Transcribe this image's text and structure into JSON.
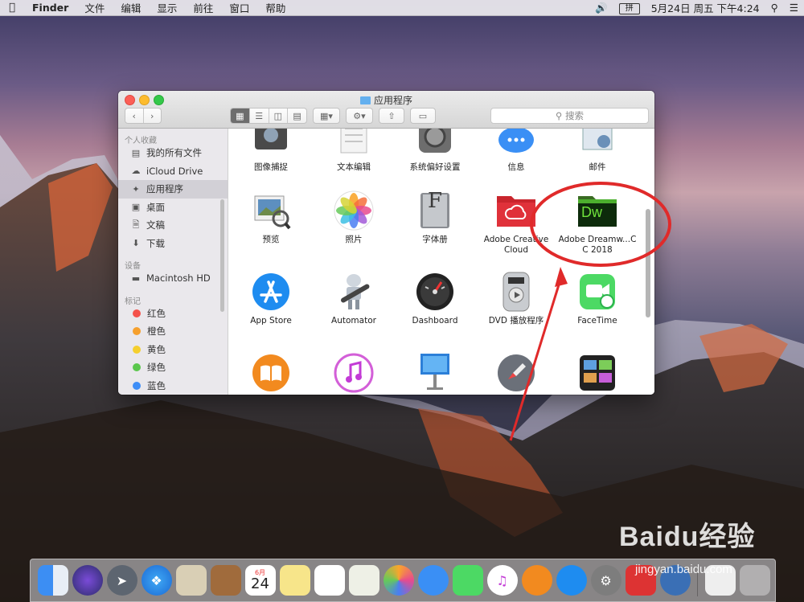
{
  "menubar": {
    "app_name": "Finder",
    "items": [
      "文件",
      "编辑",
      "显示",
      "前往",
      "窗口",
      "帮助"
    ],
    "ime": "拼",
    "clock": "5月24日 周五 下午4:24"
  },
  "window": {
    "title": "应用程序",
    "search_placeholder": "搜索"
  },
  "sidebar": {
    "favorites_header": "个人收藏",
    "favorites": [
      "我的所有文件",
      "iCloud Drive",
      "应用程序",
      "桌面",
      "文稿",
      "下载"
    ],
    "devices_header": "设备",
    "devices": [
      "Macintosh HD"
    ],
    "tags_header": "标记",
    "tags": [
      {
        "label": "红色",
        "color": "#f4524b"
      },
      {
        "label": "橙色",
        "color": "#f6a02d"
      },
      {
        "label": "黄色",
        "color": "#f5cf2e"
      },
      {
        "label": "绿色",
        "color": "#5bc74d"
      },
      {
        "label": "蓝色",
        "color": "#3e8ef7"
      }
    ]
  },
  "apps": {
    "row1": [
      "图像捕捉",
      "文本编辑",
      "系统偏好设置",
      "信息",
      "邮件"
    ],
    "row2": [
      "预览",
      "照片",
      "字体册",
      "Adobe Creative Cloud",
      "Adobe Dreamw...CC 2018"
    ],
    "row3": [
      "App Store",
      "Automator",
      "Dashboard",
      "DVD 播放程序",
      "FaceTime"
    ],
    "dw_icon_text": "Dw",
    "font_icon_text": "F"
  },
  "dock": {
    "calendar_month": "6月",
    "calendar_day": "24"
  },
  "watermark": {
    "brand": "Baidu经验",
    "url": "jingyan.baidu.com"
  },
  "colors": {
    "annotation_red": "#e02a2a",
    "selection": "#d2d0d6"
  }
}
